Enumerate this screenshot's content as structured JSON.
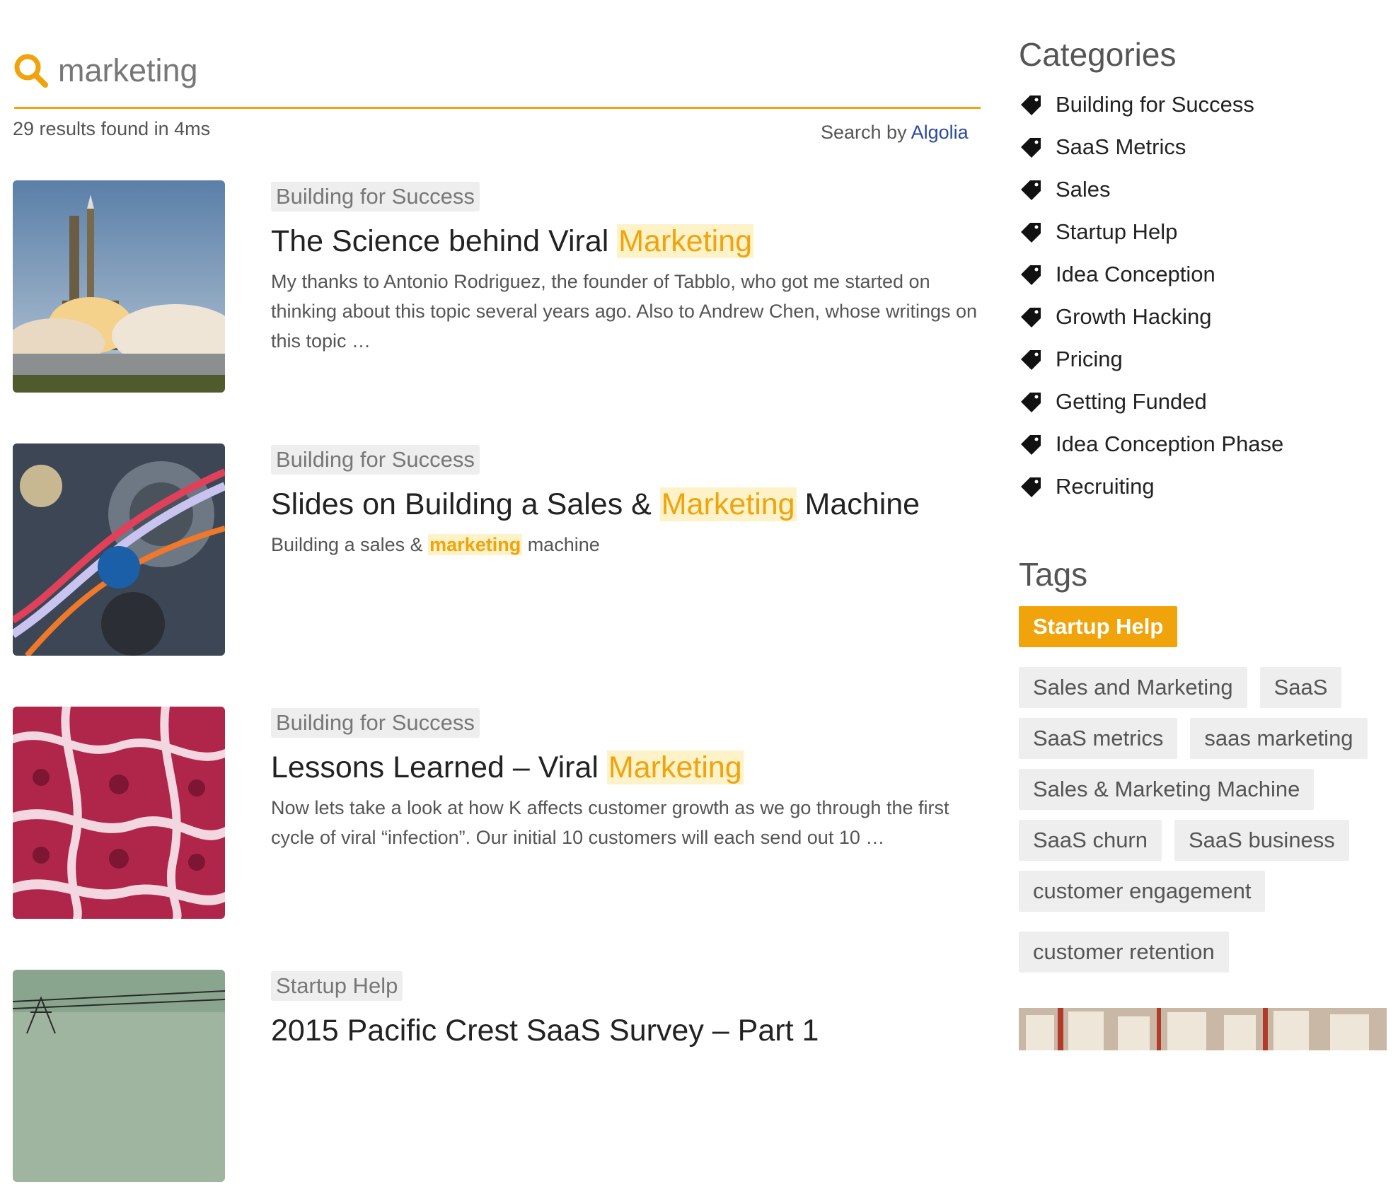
{
  "search": {
    "query": "marketing",
    "results_count": "29 results found in 4ms",
    "search_by": "Search by",
    "provider": "Algolia"
  },
  "results": [
    {
      "category": "Building for Success",
      "title_before": "The Science behind Viral ",
      "title_highlight": "Marketing",
      "title_after": "",
      "description": "My thanks to Antonio Rodriguez, the founder of Tabblo, who got me started on thinking about this topic several years ago. Also to Andrew Chen, whose writings on this topic …"
    },
    {
      "category": "Building for Success",
      "title_before": "Slides on Building a Sales & ",
      "title_highlight": "Marketing",
      "title_after": " Machine",
      "desc_before": "Building a sales & ",
      "desc_highlight": "marketing",
      "desc_after": " machine"
    },
    {
      "category": "Building for Success",
      "title_before": "Lessons Learned – Viral ",
      "title_highlight": "Marketing",
      "title_after": "",
      "description": "Now lets take a look at how K affects customer growth as we go through the first cycle of viral “infection”. Our initial 10 customers will each send out 10 …"
    },
    {
      "category": "Startup Help",
      "title_before": "2015 Pacific Crest SaaS Survey – Part 1",
      "title_highlight": "",
      "title_after": ""
    }
  ],
  "sidebar": {
    "categories_heading": "Categories",
    "categories": [
      "Building for Success",
      "SaaS Metrics",
      "Sales",
      "Startup Help",
      "Idea Conception",
      "Growth Hacking",
      "Pricing",
      "Getting Funded",
      "Idea Conception Phase",
      "Recruiting"
    ],
    "tags_heading": "Tags",
    "tags": [
      "Startup Help",
      "Sales and Marketing",
      "SaaS",
      "SaaS metrics",
      "saas marketing",
      "Sales & Marketing Machine",
      "SaaS churn",
      "SaaS business",
      "customer engagement",
      "customer retention"
    ]
  },
  "colors": {
    "accent": "#f0a30a",
    "highlight_bg": "#fdf2c8"
  }
}
